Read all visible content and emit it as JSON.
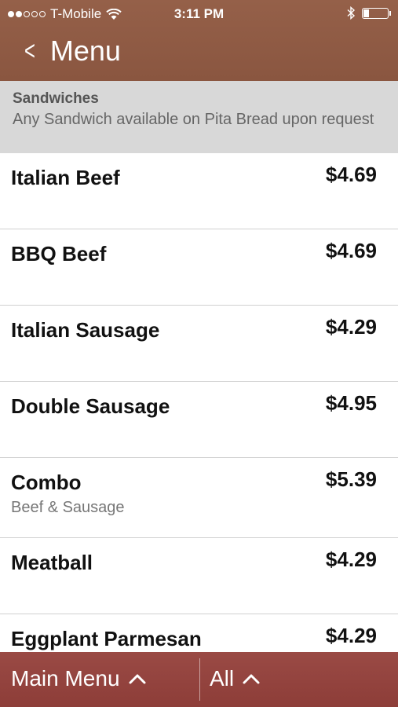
{
  "status": {
    "carrier": "T-Mobile",
    "time": "3:11 PM",
    "signal_bars_filled": 2,
    "signal_bars_total": 5,
    "battery_level": 0.25
  },
  "nav": {
    "back_label": "Menu"
  },
  "section": {
    "title": "Sandwiches",
    "description": "Any Sandwich available on Pita Bread upon request"
  },
  "items": [
    {
      "name": "Italian Beef",
      "price": "$4.69",
      "sub": ""
    },
    {
      "name": "BBQ Beef",
      "price": "$4.69",
      "sub": ""
    },
    {
      "name": "Italian Sausage",
      "price": "$4.29",
      "sub": ""
    },
    {
      "name": "Double Sausage",
      "price": "$4.95",
      "sub": ""
    },
    {
      "name": "Combo",
      "price": "$5.39",
      "sub": "Beef & Sausage"
    },
    {
      "name": "Meatball",
      "price": "$4.29",
      "sub": ""
    },
    {
      "name": "Eggplant Parmesan",
      "price": "$4.29",
      "sub": ""
    }
  ],
  "bottom": {
    "main_menu_label": "Main Menu",
    "filter_label": "All"
  },
  "colors": {
    "topbar": "#8e5a43",
    "bottombar": "#923f3a",
    "section_bg": "#d8d8d8"
  }
}
